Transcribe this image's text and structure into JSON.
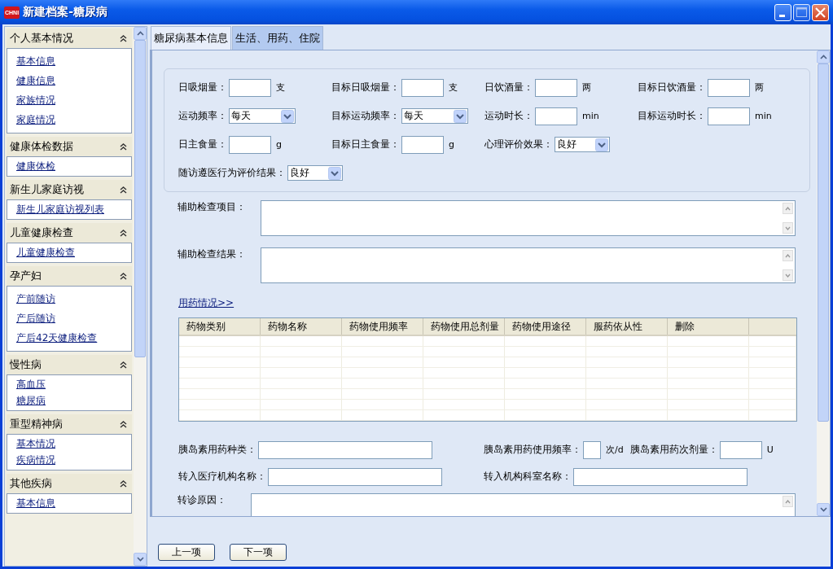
{
  "window": {
    "logo": "CHNI",
    "title": "新建档案-糖尿病"
  },
  "sidebar": {
    "groups": [
      {
        "title": "个人基本情况",
        "expanded": true,
        "items": [
          "基本信息",
          "健康信息",
          "家族情况",
          "家庭情况"
        ]
      },
      {
        "title": "健康体检数据",
        "expanded": true,
        "items": [
          "健康体检"
        ]
      },
      {
        "title": "新生儿家庭访视",
        "expanded": true,
        "items": [
          "新生儿家庭访视列表"
        ]
      },
      {
        "title": "儿童健康检查",
        "expanded": true,
        "items": [
          "儿童健康检查"
        ]
      },
      {
        "title": "孕产妇",
        "expanded": true,
        "items": [
          "产前随访",
          "产后随访",
          "产后42天健康检查"
        ]
      },
      {
        "title": "慢性病",
        "expanded": true,
        "items": [
          "高血压",
          "糖尿病"
        ]
      },
      {
        "title": "重型精神病",
        "expanded": true,
        "items": [
          "基本情况",
          "疾病情况"
        ]
      },
      {
        "title": "其他疾病",
        "expanded": true,
        "items": [
          "基本信息"
        ]
      }
    ]
  },
  "tabs": [
    {
      "label": "糖尿病基本信息",
      "selected": false
    },
    {
      "label": "生活、用药、住院",
      "selected": true
    }
  ],
  "form": {
    "rows": [
      [
        {
          "label": "日吸烟量：",
          "kind": "field",
          "unit": "支"
        },
        {
          "label": "目标日吸烟量：",
          "kind": "field",
          "unit": "支"
        },
        {
          "label": "日饮酒量：",
          "kind": "field",
          "unit": "两"
        },
        {
          "label": "目标日饮酒量：",
          "kind": "field",
          "unit": "两"
        }
      ],
      [
        {
          "label": "运动频率：",
          "kind": "select",
          "value": "每天"
        },
        {
          "label": "目标运动频率：",
          "kind": "select",
          "value": "每天"
        },
        {
          "label": "运动时长：",
          "kind": "field",
          "unit": "min"
        },
        {
          "label": "目标运动时长：",
          "kind": "field",
          "unit": "min"
        }
      ],
      [
        {
          "label": "日主食量：",
          "kind": "field",
          "unit": "g"
        },
        {
          "label": "目标日主食量：",
          "kind": "field",
          "unit": "g"
        },
        {
          "label": "心理评价效果：",
          "kind": "small-select",
          "value": "良好"
        }
      ],
      [
        {
          "label": "随访遵医行为评价结果：",
          "kind": "small-select",
          "value": "良好"
        }
      ]
    ],
    "textareas": [
      {
        "label": "辅助检查项目："
      },
      {
        "label": "辅助检查结果："
      }
    ],
    "medication_link": "用药情况>>",
    "medication_table": {
      "columns": [
        "药物类别",
        "药物名称",
        "药物使用频率",
        "药物使用总剂量",
        "药物使用途径",
        "服药依从性",
        "删除"
      ]
    },
    "lower_rows": [
      [
        {
          "label": "胰岛素用药种类：",
          "kind": "wide-field"
        },
        {
          "label": "胰岛素用药使用频率：",
          "kind": "tiny-field",
          "unit": "次/d"
        },
        {
          "label": "胰岛素用药次剂量：",
          "kind": "field",
          "unit": "U"
        }
      ],
      [
        {
          "label": "转入医疗机构名称：",
          "kind": "wide-field"
        },
        {
          "label": "转入机构科室名称：",
          "kind": "wide-field"
        }
      ]
    ],
    "referral_reason": {
      "label": "转诊原因："
    }
  },
  "buttons": [
    "上一项",
    "下一项"
  ]
}
